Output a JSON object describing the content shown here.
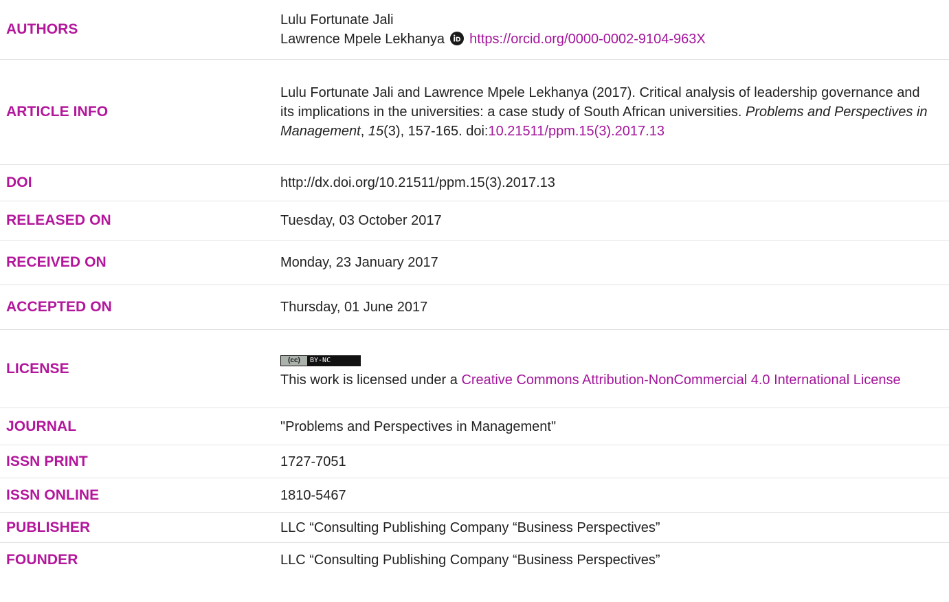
{
  "rows": {
    "authors": {
      "label": "AUTHORS",
      "author1": "Lulu Fortunate Jali",
      "author2": "Lawrence Mpele Lekhanya",
      "orcid_link": "https://orcid.org/0000-0002-9104-963X",
      "icon": "orcid-icon"
    },
    "article_info": {
      "label": "ARTICLE INFO",
      "citation_text": "Lulu Fortunate Jali and Lawrence Mpele Lekhanya (2017). Critical analysis of leadership governance and its implications in the universities: a case study of South African universities. ",
      "journal_name": "Problems and Perspectives in Management",
      "comma1": ", ",
      "volume": "15",
      "issue_pages": "(3), 157-165. doi:",
      "doi_link": "10.21511/ppm.15(3).2017.13"
    },
    "doi": {
      "label": "DOI",
      "value": "http://dx.doi.org/10.21511/ppm.15(3).2017.13"
    },
    "released_on": {
      "label": "RELEASED ON",
      "value": "Tuesday, 03 October 2017"
    },
    "received_on": {
      "label": "RECEIVED ON",
      "value": "Monday, 23 January 2017"
    },
    "accepted_on": {
      "label": "ACCEPTED ON",
      "value": "Thursday, 01 June 2017"
    },
    "license": {
      "label": "LICENSE",
      "badge_left": "(cc)",
      "badge_right": "BY-NC",
      "text": "This work is licensed under a ",
      "link": "Creative Commons Attribution-NonCommercial 4.0 International License"
    },
    "journal": {
      "label": "JOURNAL",
      "value": "\"Problems and Perspectives in Management\""
    },
    "issn_print": {
      "label": "ISSN PRINT",
      "value": "1727-7051"
    },
    "issn_online": {
      "label": "ISSN ONLINE",
      "value": "1810-5467"
    },
    "publisher": {
      "label": "PUBLISHER",
      "value": "LLC “Consulting Publishing Company “Business Perspectives”"
    },
    "founder": {
      "label": "FOUNDER",
      "value": "LLC “Consulting Publishing Company “Business Perspectives”"
    }
  },
  "colors": {
    "label": "#b3169b",
    "link": "#a3159b",
    "text": "#222222",
    "divider": "#e3e3e3"
  }
}
